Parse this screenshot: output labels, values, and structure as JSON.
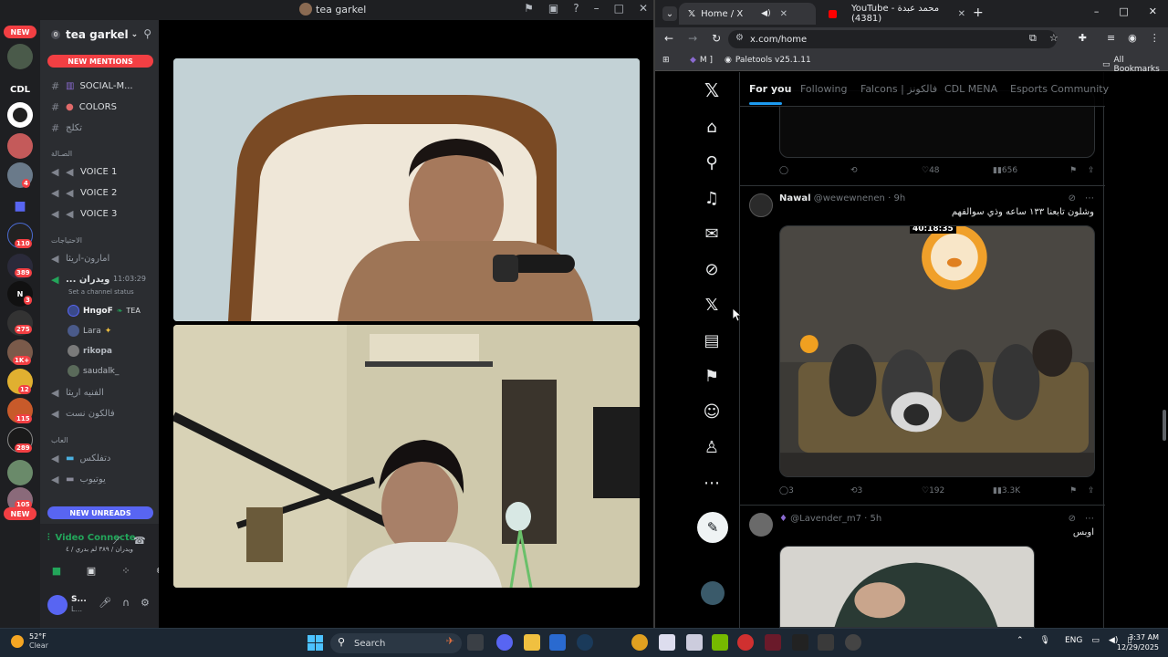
{
  "discord": {
    "window_title": "tea garkel",
    "server": {
      "name": "tea garkel",
      "count_badge": "0"
    },
    "guilds": {
      "new_top": "NEW",
      "new_bottom": "NEW",
      "cdl": "CDL",
      "badges": [
        "4",
        "110",
        "389",
        "3",
        "275",
        "1K+",
        "12",
        "115",
        "289",
        "105"
      ]
    },
    "new_mentions": "NEW MENTIONS",
    "new_unreads": "NEW UNREADS",
    "channels": {
      "social": "SOCIAL-M...",
      "colors": "COLORS",
      "channel3": "تكلج",
      "category_voice": "الصـالة",
      "voice1": "VOICE 1",
      "voice2": "VOICE 2",
      "voice3": "VOICE 3",
      "category_events": "الاحتياجات",
      "events1": "امارون-اريثا",
      "active_voice": "... ويدران",
      "active_time": "11:03:29",
      "status_hint": "Set a channel status",
      "voice_users": [
        {
          "name": "HngoF",
          "tag": "TEA"
        },
        {
          "name": "Lara"
        },
        {
          "name": "rikopa"
        },
        {
          "name": "saudalk_"
        }
      ],
      "voice_a": "الفنيه اريثا",
      "voice_b": "فالكون نست",
      "category_games": "العاب",
      "game1": "دتفلكس",
      "game2": "يوتيوب"
    },
    "voice_panel": {
      "status": "Video Connecte",
      "subtitle": "ويدران / ٣٨٩ لم بدري / ٤"
    },
    "user_panel": {
      "name": "S...",
      "sub": "L..."
    }
  },
  "browser": {
    "tabs": [
      {
        "label": "Home / X",
        "active": true
      },
      {
        "label": "YouTube - محمد عبدة (4381)",
        "active": false
      }
    ],
    "url": "x.com/home",
    "bookmarks": [
      {
        "label": "M ]"
      },
      {
        "label": "Paletools v25.1.11"
      },
      {
        "label": "All Bookmarks"
      }
    ]
  },
  "x": {
    "tabs": [
      "For you",
      "Following",
      "Falcons | فالكونز",
      "CDL MENA",
      "Esports Community"
    ],
    "posts": [
      {
        "stats": {
          "replies": "",
          "reposts": "",
          "likes": "48",
          "views": "656"
        }
      },
      {
        "author": "Nawal",
        "handle": "@wewewnenen",
        "time": "9h",
        "text": "وشلون تابعنا ١٣٣ ساعه وذي سوالفهم",
        "video_timestamp": "40:18:35",
        "stats": {
          "replies": "3",
          "reposts": "3",
          "likes": "192",
          "views": "3.3K"
        }
      },
      {
        "author": "",
        "handle": "@Lavender_m7",
        "time": "5h",
        "text": "اوبس"
      }
    ]
  },
  "taskbar": {
    "temp": "52°F",
    "weather": "Clear",
    "search": "Search",
    "lang": "ENG",
    "time": "3:37 AM",
    "date": "12/29/2025"
  }
}
